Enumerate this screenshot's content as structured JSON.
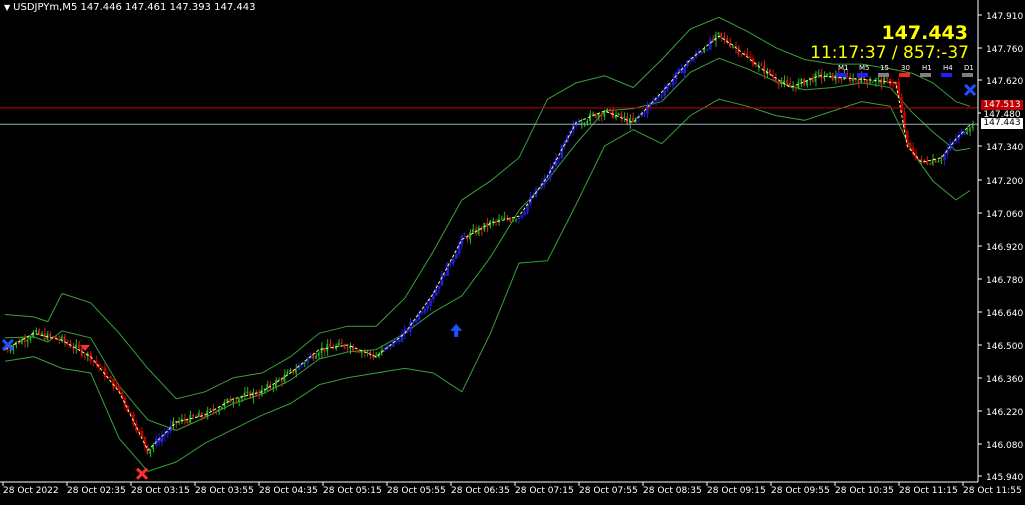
{
  "header": {
    "symbol": "USDJPYm,M5",
    "ohlc": "147.446 147.461 147.393 147.443"
  },
  "overlay": {
    "big_price": "147.443",
    "timer": "11:17:37 / 857:-37",
    "timeframes": [
      "M1",
      "M5",
      "15",
      "30",
      "H1",
      "H4",
      "D1"
    ],
    "tf_colors": [
      "#2020ff",
      "#2020ff",
      "#808080",
      "#ff2020",
      "#808080",
      "#2020ff",
      "#808080"
    ]
  },
  "price_labels": {
    "red_line": "147.513",
    "mid": "147.480",
    "current": "147.443"
  },
  "colors": {
    "bull_candle": "#1f1fd6",
    "bear_candle": "#c00000",
    "band": "#3aa03a",
    "mid_trend": "#ffff80",
    "red_line": "#c00000",
    "current_line": "#8fb3b3",
    "grid_text": "#ffffff"
  },
  "chart_data": {
    "type": "candlestick",
    "ylim": [
      145.94,
      147.91
    ],
    "y_ticks": [
      "147.910",
      "147.760",
      "147.620",
      "147.480",
      "147.340",
      "147.200",
      "147.060",
      "146.920",
      "146.780",
      "146.640",
      "146.500",
      "146.360",
      "146.220",
      "146.080",
      "145.940"
    ],
    "x_labels": [
      "28 Oct 2022",
      "28 Oct 02:35",
      "28 Oct 03:15",
      "28 Oct 03:55",
      "28 Oct 04:35",
      "28 Oct 05:15",
      "28 Oct 05:55",
      "28 Oct 06:35",
      "28 Oct 07:15",
      "28 Oct 07:55",
      "28 Oct 08:35",
      "28 Oct 09:15",
      "28 Oct 09:55",
      "28 Oct 10:35",
      "28 Oct 11:15",
      "28 Oct 11:55"
    ],
    "red_line_level": 147.513,
    "current_level": 147.443,
    "key_closes": [
      [
        0,
        146.48
      ],
      [
        10,
        146.55
      ],
      [
        20,
        146.52
      ],
      [
        30,
        146.45
      ],
      [
        40,
        146.3
      ],
      [
        50,
        146.05
      ],
      [
        60,
        146.17
      ],
      [
        70,
        146.2
      ],
      [
        80,
        146.27
      ],
      [
        90,
        146.3
      ],
      [
        100,
        146.38
      ],
      [
        110,
        146.48
      ],
      [
        120,
        146.5
      ],
      [
        130,
        146.45
      ],
      [
        140,
        146.55
      ],
      [
        150,
        146.72
      ],
      [
        160,
        146.95
      ],
      [
        170,
        147.02
      ],
      [
        180,
        147.05
      ],
      [
        190,
        147.22
      ],
      [
        200,
        147.45
      ],
      [
        210,
        147.5
      ],
      [
        220,
        147.45
      ],
      [
        230,
        147.58
      ],
      [
        240,
        147.72
      ],
      [
        250,
        147.82
      ],
      [
        255,
        147.78
      ],
      [
        265,
        147.68
      ],
      [
        275,
        147.6
      ],
      [
        285,
        147.65
      ],
      [
        295,
        147.64
      ],
      [
        305,
        147.63
      ],
      [
        312,
        147.62
      ],
      [
        316,
        147.35
      ],
      [
        321,
        147.28
      ],
      [
        328,
        147.3
      ],
      [
        333,
        147.38
      ],
      [
        338,
        147.44
      ]
    ],
    "upper_band": [
      [
        0,
        146.63
      ],
      [
        10,
        146.62
      ],
      [
        15,
        146.6
      ],
      [
        20,
        146.72
      ],
      [
        30,
        146.68
      ],
      [
        40,
        146.55
      ],
      [
        50,
        146.4
      ],
      [
        60,
        146.27
      ],
      [
        70,
        146.3
      ],
      [
        80,
        146.36
      ],
      [
        90,
        146.38
      ],
      [
        100,
        146.45
      ],
      [
        110,
        146.55
      ],
      [
        120,
        146.58
      ],
      [
        130,
        146.58
      ],
      [
        140,
        146.7
      ],
      [
        150,
        146.9
      ],
      [
        160,
        147.12
      ],
      [
        170,
        147.2
      ],
      [
        180,
        147.3
      ],
      [
        190,
        147.55
      ],
      [
        200,
        147.62
      ],
      [
        210,
        147.65
      ],
      [
        220,
        147.6
      ],
      [
        230,
        147.72
      ],
      [
        240,
        147.85
      ],
      [
        250,
        147.9
      ],
      [
        260,
        147.84
      ],
      [
        270,
        147.77
      ],
      [
        280,
        147.72
      ],
      [
        290,
        147.7
      ],
      [
        300,
        147.7
      ],
      [
        310,
        147.68
      ],
      [
        318,
        147.66
      ],
      [
        325,
        147.62
      ],
      [
        333,
        147.54
      ],
      [
        338,
        147.52
      ]
    ],
    "lower_band": [
      [
        0,
        146.43
      ],
      [
        10,
        146.45
      ],
      [
        20,
        146.4
      ],
      [
        30,
        146.38
      ],
      [
        40,
        146.1
      ],
      [
        50,
        145.96
      ],
      [
        60,
        146.0
      ],
      [
        70,
        146.08
      ],
      [
        80,
        146.14
      ],
      [
        90,
        146.2
      ],
      [
        100,
        146.25
      ],
      [
        110,
        146.33
      ],
      [
        120,
        146.36
      ],
      [
        130,
        146.38
      ],
      [
        140,
        146.4
      ],
      [
        150,
        146.38
      ],
      [
        160,
        146.3
      ],
      [
        170,
        146.55
      ],
      [
        180,
        146.85
      ],
      [
        190,
        146.86
      ],
      [
        200,
        147.1
      ],
      [
        210,
        147.35
      ],
      [
        220,
        147.42
      ],
      [
        230,
        147.36
      ],
      [
        240,
        147.48
      ],
      [
        250,
        147.55
      ],
      [
        260,
        147.52
      ],
      [
        270,
        147.48
      ],
      [
        280,
        147.46
      ],
      [
        290,
        147.5
      ],
      [
        300,
        147.54
      ],
      [
        310,
        147.52
      ],
      [
        318,
        147.32
      ],
      [
        325,
        147.2
      ],
      [
        333,
        147.12
      ],
      [
        338,
        147.16
      ]
    ],
    "markers": [
      {
        "type": "cross",
        "color": "#2050ff",
        "x": 1,
        "y": 146.5
      },
      {
        "type": "cross",
        "color": "#ff3030",
        "x": 48,
        "y": 145.95
      },
      {
        "type": "arrow-up",
        "color": "#2050ff",
        "x": 158,
        "y": 146.56
      },
      {
        "type": "cross",
        "color": "#2050ff",
        "x": 338,
        "y": 147.59
      },
      {
        "type": "arrow-down",
        "color": "#ff3030",
        "x": 28,
        "y": 146.5
      }
    ]
  }
}
